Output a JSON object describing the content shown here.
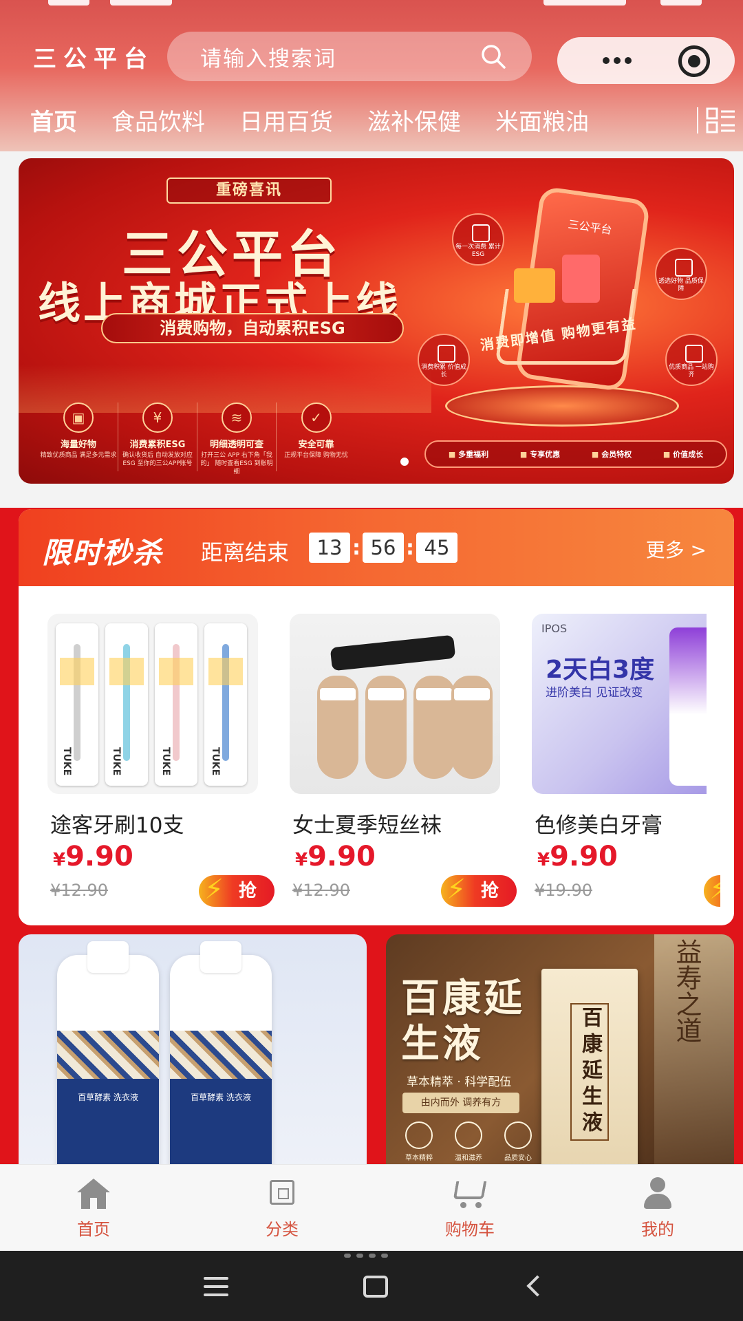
{
  "header": {
    "brand": "三公平台",
    "search_placeholder": "请输入搜索词",
    "categories": [
      {
        "label": "首页",
        "active": true
      },
      {
        "label": "食品饮料"
      },
      {
        "label": "日用百货"
      },
      {
        "label": "滋补保健"
      },
      {
        "label": "米面粮油"
      }
    ]
  },
  "banner": {
    "ribbon": "重磅喜讯",
    "title_line1": "三公平台",
    "title_line2": "线上商城正式上线",
    "slogan": "消费购物，自动累积ESG",
    "phone_text": "三公平台",
    "curve_text": "消费即增值 购物更有益",
    "features": [
      {
        "icon": "bag-icon",
        "name": "海量好物",
        "desc": "精致优质商品 满足多元需求"
      },
      {
        "icon": "yen-icon",
        "name": "消费累积ESG",
        "desc": "确认收货后 自动发放对应ESG 至你的三公APP账号"
      },
      {
        "icon": "coins-icon",
        "name": "明细透明可查",
        "desc": "打开三公 APP 右下角「我的」 随时查看ESG 到账明细"
      },
      {
        "icon": "shield-icon",
        "name": "安全可靠",
        "desc": "正规平台保障 购物无忧"
      }
    ],
    "bubbles": [
      {
        "text": "每一次消费 累计ESG"
      },
      {
        "text": "透选好物 品质保障"
      },
      {
        "text": "消费积累 价值成长"
      },
      {
        "text": "优质商品 一站购齐"
      }
    ],
    "perks": [
      "多重福利",
      "专享优惠",
      "会员特权",
      "价值成长"
    ]
  },
  "flash_sale": {
    "title": "限时秒杀",
    "countdown_label": "距离结束",
    "hours": "13",
    "minutes": "56",
    "seconds": "45",
    "more": "更多 >",
    "products": [
      {
        "name": "途客牙刷10支",
        "currency": "¥",
        "price": "9.90",
        "original_price": "¥12.90",
        "button": "抢",
        "brush_label": "TUKE"
      },
      {
        "name": "女士夏季短丝袜",
        "currency": "¥",
        "price": "9.90",
        "original_price": "¥12.90",
        "button": "抢"
      },
      {
        "name": "色修美白牙膏",
        "currency": "¥",
        "price": "9.90",
        "original_price": "¥19.90",
        "button": "抢",
        "brand": "IPOS",
        "headline": "2天白3度",
        "subline": "进阶美白 见证改变"
      }
    ]
  },
  "promos": {
    "left": {
      "bottle_text": "百草酵素 洗衣液"
    },
    "right": {
      "title": "百康延生液",
      "sub": "草本精萃 · 科学配伍",
      "ribbon": "由内而外 调养有方",
      "icons": [
        "草本精粹",
        "温和滋养",
        "品质安心"
      ],
      "box_label": "百康延生液",
      "deco_text": "益寿之道"
    }
  },
  "tabbar": [
    {
      "label": "首页",
      "icon": "home-icon"
    },
    {
      "label": "分类",
      "icon": "category-icon"
    },
    {
      "label": "购物车",
      "icon": "cart-icon"
    },
    {
      "label": "我的",
      "icon": "user-icon"
    }
  ],
  "colors": {
    "accent": "#e5182a",
    "header_red": "#d9534f",
    "tab_label": "#d5533f",
    "sale_bg": "#e0141a"
  }
}
